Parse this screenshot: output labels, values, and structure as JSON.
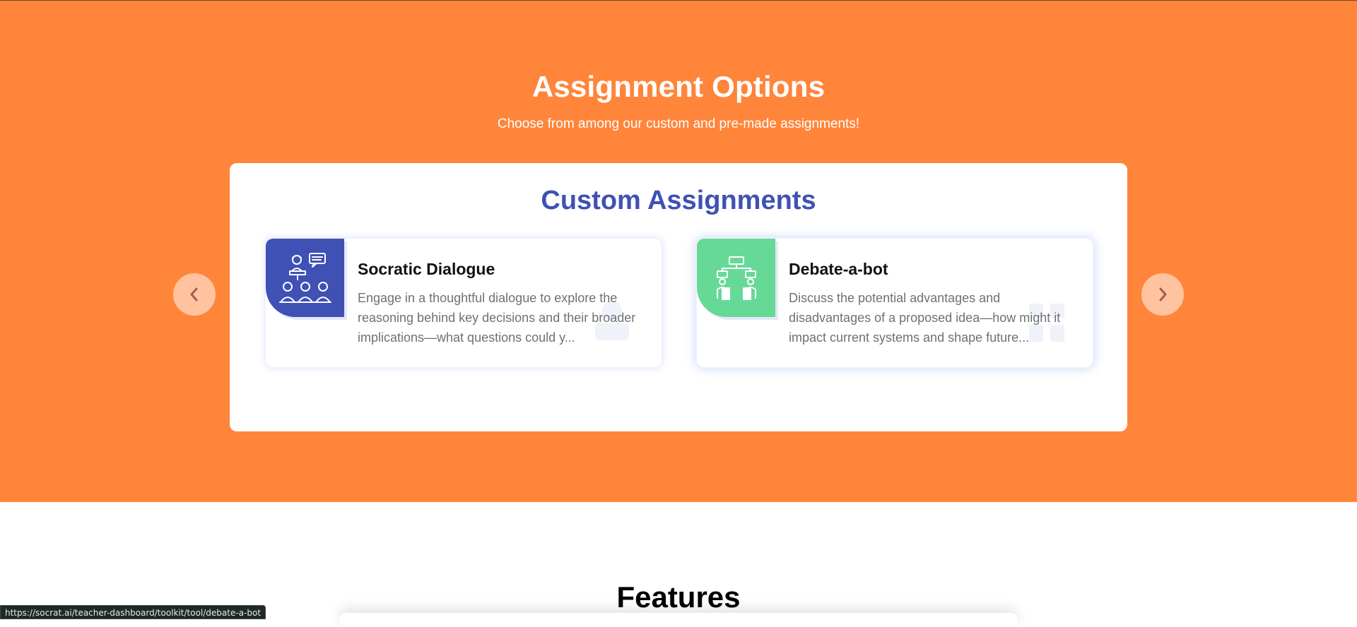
{
  "section": {
    "title": "Assignment Options",
    "subtitle": "Choose from among our custom and pre-made assignments!"
  },
  "panel": {
    "title": "Custom Assignments"
  },
  "cards": [
    {
      "title": "Socratic Dialogue",
      "description": "Engage in a thoughtful dialogue to explore the reasoning behind key decisions and their broader implications—what questions could y...",
      "icon": "classroom-discussion-icon",
      "icon_bg": "#3f51b5"
    },
    {
      "title": "Debate-a-bot",
      "description": "Discuss the potential advantages and disadvantages of a proposed idea—how might it impact current systems and shape future...",
      "icon": "debate-icon",
      "icon_bg": "#66d997"
    }
  ],
  "nav": {
    "prev_icon": "chevron-left-icon",
    "next_icon": "chevron-right-icon"
  },
  "features": {
    "title": "Features"
  },
  "status_url": "https://socrat.ai/teacher-dashboard/toolkit/tool/debate-a-bot",
  "colors": {
    "accent_orange": "#ff853a",
    "brand_blue": "#3f51b5",
    "brand_green": "#66d997"
  }
}
